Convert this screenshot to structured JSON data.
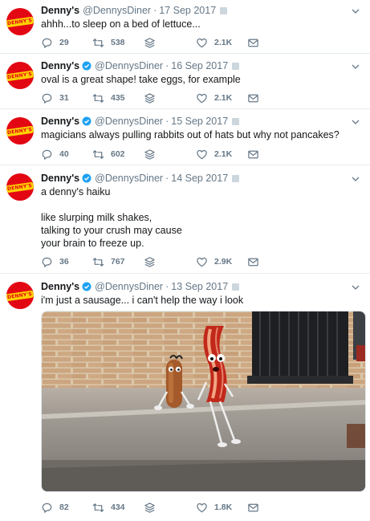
{
  "tweets": [
    {
      "name": "Denny's",
      "handle": "@DennysDiner",
      "date": "17 Sep 2017",
      "lines": [
        "ahhh...to sleep on a bed of lettuce..."
      ],
      "replies": "29",
      "retweets": "538",
      "likes": "2.1K",
      "verified": false
    },
    {
      "name": "Denny's",
      "handle": "@DennysDiner",
      "date": "16 Sep 2017",
      "lines": [
        "oval is a great shape! take eggs, for example"
      ],
      "replies": "31",
      "retweets": "435",
      "likes": "2.1K",
      "verified": true
    },
    {
      "name": "Denny's",
      "handle": "@DennysDiner",
      "date": "15 Sep 2017",
      "lines": [
        "magicians always pulling rabbits out of hats but why not pancakes?"
      ],
      "replies": "40",
      "retweets": "602",
      "likes": "2.1K",
      "verified": true
    },
    {
      "name": "Denny's",
      "handle": "@DennysDiner",
      "date": "14 Sep 2017",
      "lines": [
        "a denny's haiku",
        "",
        "like slurping milk shakes,",
        "talking to your crush may cause",
        "your brain to freeze up."
      ],
      "replies": "36",
      "retweets": "767",
      "likes": "2.9K",
      "verified": true
    },
    {
      "name": "Denny's",
      "handle": "@DennysDiner",
      "date": "13 Sep 2017",
      "lines": [
        "i'm just a sausage... i can't help the way i look"
      ],
      "replies": "82",
      "retweets": "434",
      "likes": "1.8K",
      "verified": true
    }
  ],
  "avatar_logo_text": "DENNY'S",
  "separator": "·",
  "colors": {
    "avatar_red": "#e30613",
    "logo_yellow": "#ffd200",
    "verified_blue": "#1da1f2",
    "muted_gray": "#657786",
    "text": "#14171a"
  },
  "icons": [
    "reply-icon",
    "retweet-icon",
    "stack-icon",
    "heart-icon",
    "mail-icon",
    "chevron-down-icon",
    "verified-icon"
  ]
}
